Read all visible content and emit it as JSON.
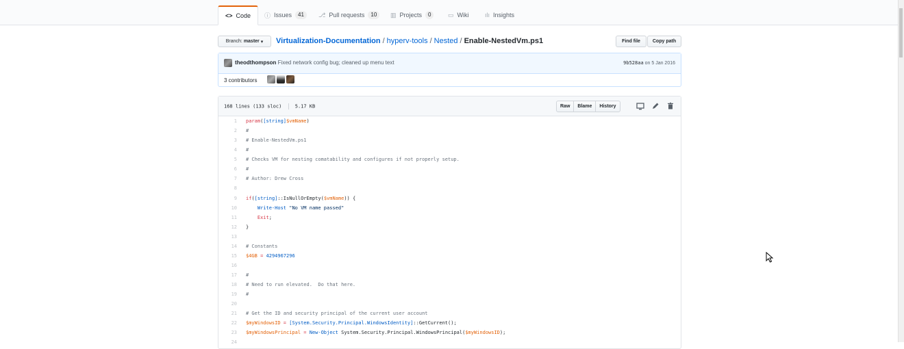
{
  "tabs": [
    {
      "label": "Code",
      "icon": "code-icon",
      "glyph": "<>"
    },
    {
      "label": "Issues",
      "count": "41",
      "icon": "issue-icon",
      "glyph": "ⓘ"
    },
    {
      "label": "Pull requests",
      "count": "10",
      "icon": "pull-request-icon",
      "glyph": "⎇"
    },
    {
      "label": "Projects",
      "count": "0",
      "icon": "project-icon",
      "glyph": "▥"
    },
    {
      "label": "Wiki",
      "icon": "book-icon",
      "glyph": "▭"
    },
    {
      "label": "Insights",
      "icon": "graph-icon",
      "glyph": "ılı"
    }
  ],
  "branch": {
    "label": "Branch:",
    "name": "master"
  },
  "breadcrumb": {
    "repo": "Virtualization-Documentation",
    "folder1": "hyperv-tools",
    "folder2": "Nested",
    "file": "Enable-NestedVm.ps1",
    "separator": "/"
  },
  "file_actions": {
    "find_file": "Find file",
    "copy_path": "Copy path"
  },
  "commit": {
    "author": "theodthompson",
    "message": "Fixed network config bug; cleaned up menu text",
    "sha": "9b528aa",
    "date": "on 5 Jan 2016"
  },
  "contributors": {
    "label": "3 contributors"
  },
  "file_info": {
    "lines": "168 lines (133 sloc)",
    "size": "5.17 KB"
  },
  "file_buttons": {
    "raw": "Raw",
    "blame": "Blame",
    "history": "History"
  },
  "colors": {
    "accent": "#e36209",
    "link": "#0366d6",
    "keyword": "#d73a49",
    "comment": "#6a737d",
    "string": "#032f62"
  },
  "code_lines": [
    {
      "n": "1",
      "t": [
        [
          "k",
          "param"
        ],
        [
          "n",
          "("
        ],
        [
          "b",
          "[string]"
        ],
        [
          "v",
          "$vmName"
        ],
        [
          "n",
          ")"
        ]
      ]
    },
    {
      "n": "2",
      "t": [
        [
          "c",
          "#"
        ]
      ]
    },
    {
      "n": "3",
      "t": [
        [
          "c",
          "# Enable-NestedVm.ps1"
        ]
      ]
    },
    {
      "n": "4",
      "t": [
        [
          "c",
          "#"
        ]
      ]
    },
    {
      "n": "5",
      "t": [
        [
          "c",
          "# Checks VM for nesting comatability and configures if not properly setup."
        ]
      ]
    },
    {
      "n": "6",
      "t": [
        [
          "c",
          "#"
        ]
      ]
    },
    {
      "n": "7",
      "t": [
        [
          "c",
          "# Author: Drew Cross"
        ]
      ]
    },
    {
      "n": "8",
      "t": []
    },
    {
      "n": "9",
      "t": [
        [
          "k",
          "if"
        ],
        [
          "n",
          "("
        ],
        [
          "b",
          "[string]"
        ],
        [
          "n",
          "::IsNullOrEmpty("
        ],
        [
          "v",
          "$vmName"
        ],
        [
          "n",
          ")) {"
        ]
      ]
    },
    {
      "n": "10",
      "t": [
        [
          "n",
          "    "
        ],
        [
          "b",
          "Write-Host"
        ],
        [
          "n",
          " "
        ],
        [
          "s",
          "\"No VM name passed\""
        ]
      ]
    },
    {
      "n": "11",
      "t": [
        [
          "n",
          "    "
        ],
        [
          "k",
          "Exit"
        ],
        [
          "n",
          ";"
        ]
      ]
    },
    {
      "n": "12",
      "t": [
        [
          "n",
          "}"
        ]
      ]
    },
    {
      "n": "13",
      "t": []
    },
    {
      "n": "14",
      "t": [
        [
          "c",
          "# Constants"
        ]
      ]
    },
    {
      "n": "15",
      "t": [
        [
          "v",
          "$4GB"
        ],
        [
          "n",
          " "
        ],
        [
          "k",
          "="
        ],
        [
          "n",
          " "
        ],
        [
          "b",
          "4294967296"
        ]
      ]
    },
    {
      "n": "16",
      "t": []
    },
    {
      "n": "17",
      "t": [
        [
          "c",
          "#"
        ]
      ]
    },
    {
      "n": "18",
      "t": [
        [
          "c",
          "# Need to run elevated.  Do that here."
        ]
      ]
    },
    {
      "n": "19",
      "t": [
        [
          "c",
          "#"
        ]
      ]
    },
    {
      "n": "20",
      "t": []
    },
    {
      "n": "21",
      "t": [
        [
          "c",
          "# Get the ID and security principal of the current user account"
        ]
      ]
    },
    {
      "n": "22",
      "t": [
        [
          "v",
          "$myWindowsID"
        ],
        [
          "n",
          " "
        ],
        [
          "k",
          "="
        ],
        [
          "n",
          " "
        ],
        [
          "b",
          "[System.Security.Principal.WindowsIdentity]"
        ],
        [
          "n",
          "::GetCurrent();"
        ]
      ]
    },
    {
      "n": "23",
      "t": [
        [
          "v",
          "$myWindowsPrincipal"
        ],
        [
          "n",
          " "
        ],
        [
          "k",
          "="
        ],
        [
          "n",
          " "
        ],
        [
          "b",
          "New-Object"
        ],
        [
          "n",
          " System.Security.Principal.WindowsPrincipal("
        ],
        [
          "v",
          "$myWindowsID"
        ],
        [
          "n",
          ");"
        ]
      ]
    },
    {
      "n": "24",
      "t": []
    }
  ]
}
